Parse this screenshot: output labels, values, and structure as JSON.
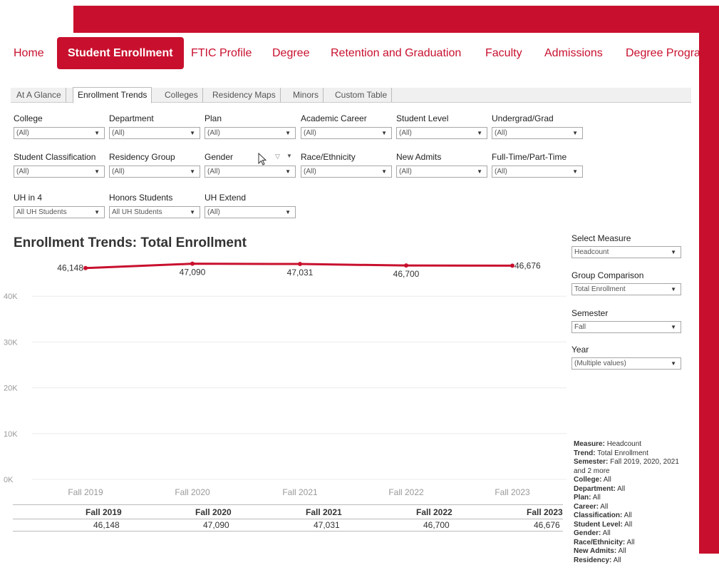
{
  "nav": {
    "items": [
      "Home",
      "Student Enrollment",
      "FTIC Profile",
      "Degree",
      "Retention and Graduation",
      "Faculty",
      "Admissions",
      "Degree Progra"
    ],
    "active_index": 1
  },
  "tabs": {
    "items": [
      "At A Glance",
      "Enrollment Trends",
      "Colleges",
      "Residency Maps",
      "Minors",
      "Custom Table"
    ],
    "active_index": 1
  },
  "filters": {
    "college": {
      "label": "College",
      "value": "(All)"
    },
    "department": {
      "label": "Department",
      "value": "(All)"
    },
    "plan": {
      "label": "Plan",
      "value": "(All)"
    },
    "academic_career": {
      "label": "Academic Career",
      "value": "(All)"
    },
    "student_level": {
      "label": "Student Level",
      "value": "(All)"
    },
    "undergrad_grad": {
      "label": "Undergrad/Grad",
      "value": "(All)"
    },
    "student_classification": {
      "label": "Student Classification",
      "value": "(All)"
    },
    "residency_group": {
      "label": "Residency Group",
      "value": "(All)"
    },
    "gender": {
      "label": "Gender",
      "value": "(All)"
    },
    "race_ethnicity": {
      "label": "Race/Ethnicity",
      "value": "(All)"
    },
    "new_admits": {
      "label": "New Admits",
      "value": "(All)"
    },
    "full_part_time": {
      "label": "Full-Time/Part-Time",
      "value": "(All)"
    },
    "uh_in_4": {
      "label": "UH in 4",
      "value": "All UH Students"
    },
    "honors_students": {
      "label": "Honors Students",
      "value": "All UH Students"
    },
    "uh_extend": {
      "label": "UH Extend",
      "value": "(All)"
    }
  },
  "side": {
    "select_measure": {
      "label": "Select Measure",
      "value": "Headcount"
    },
    "group_comparison": {
      "label": "Group Comparison",
      "value": "Total Enrollment"
    },
    "semester": {
      "label": "Semester",
      "value": "Fall"
    },
    "year": {
      "label": "Year",
      "value": "(Multiple values)"
    }
  },
  "chart_title": "Enrollment Trends: Total Enrollment",
  "chart_data": {
    "type": "line",
    "title": "Enrollment Trends: Total Enrollment",
    "categories": [
      "Fall 2019",
      "Fall 2020",
      "Fall 2021",
      "Fall 2022",
      "Fall 2023"
    ],
    "values": [
      46148,
      47090,
      47031,
      46700,
      46676
    ],
    "value_labels": [
      "46,148",
      "47,090",
      "47,031",
      "46,700",
      "46,676"
    ],
    "y_ticks": [
      0,
      10000,
      20000,
      30000,
      40000
    ],
    "y_tick_labels": [
      "0K",
      "10K",
      "20K",
      "30K",
      "40K"
    ],
    "ylim": [
      0,
      50000
    ],
    "xlabel": "",
    "ylabel": "",
    "grid": true,
    "line_color": "#c8102e"
  },
  "table": {
    "headers": [
      "Fall 2019",
      "Fall 2020",
      "Fall 2021",
      "Fall 2022",
      "Fall 2023"
    ],
    "values": [
      "46,148",
      "47,090",
      "47,031",
      "46,700",
      "46,676"
    ]
  },
  "summary": [
    {
      "key": "Measure:",
      "value": "Headcount"
    },
    {
      "key": "Trend:",
      "value": "Total Enrollment"
    },
    {
      "key": "Semester:",
      "value": "Fall 2019, 2020, 2021 and 2 more"
    },
    {
      "key": "College:",
      "value": "All"
    },
    {
      "key": "Department:",
      "value": "All"
    },
    {
      "key": "Plan:",
      "value": "All"
    },
    {
      "key": "Career:",
      "value": "All"
    },
    {
      "key": "Classification:",
      "value": "All"
    },
    {
      "key": "Student Level:",
      "value": "All"
    },
    {
      "key": "Gender:",
      "value": "All"
    },
    {
      "key": "Race/Ethnicity:",
      "value": "All"
    },
    {
      "key": "New Admits:",
      "value": "All"
    },
    {
      "key": "Residency:",
      "value": "All"
    }
  ],
  "colors": {
    "brand": "#c8102e"
  }
}
